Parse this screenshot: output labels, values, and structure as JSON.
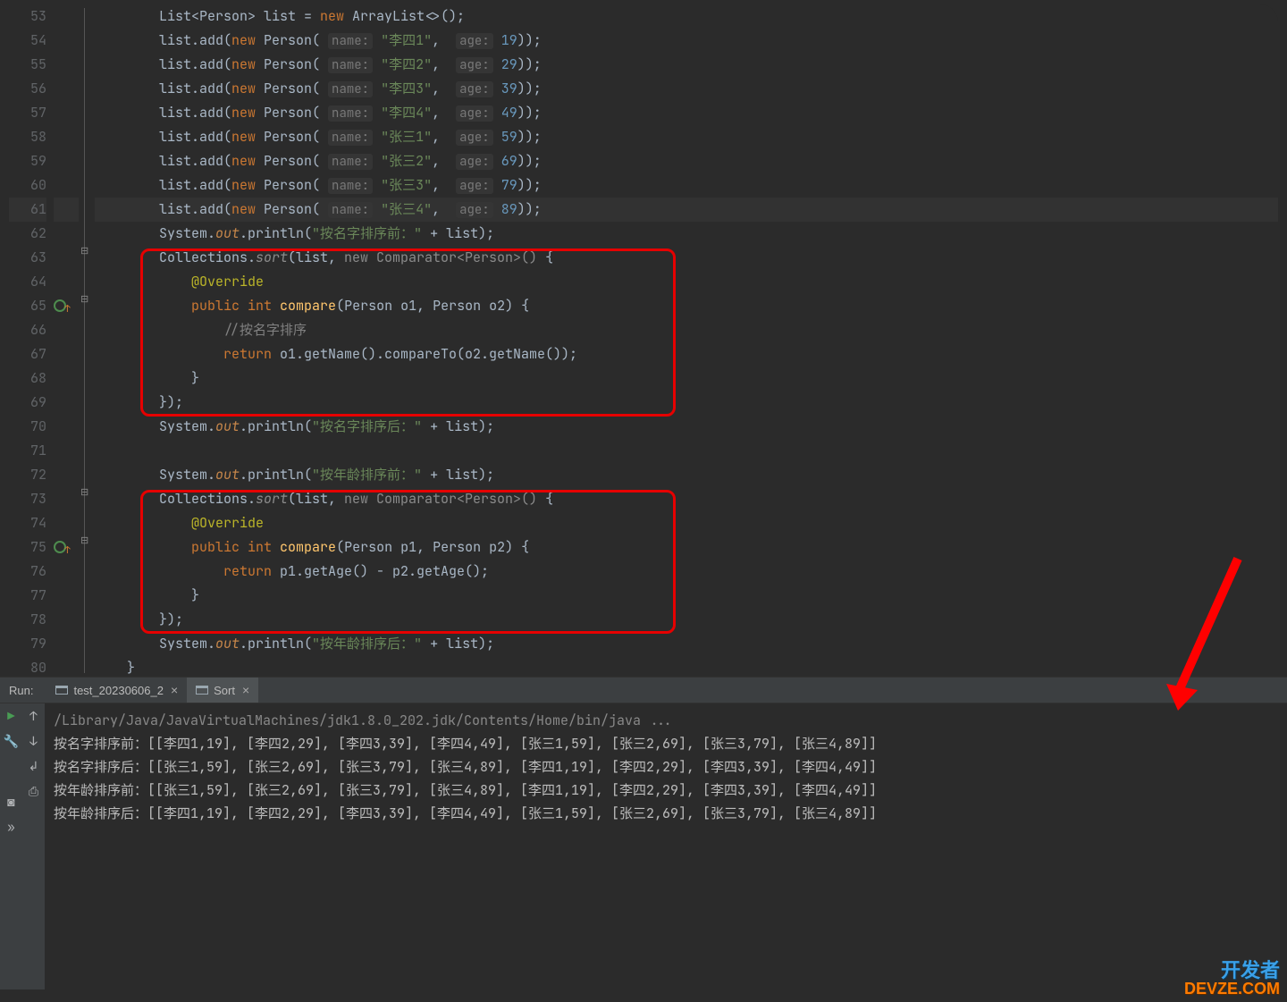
{
  "line_numbers": [
    "53",
    "54",
    "55",
    "56",
    "57",
    "58",
    "59",
    "60",
    "61",
    "62",
    "63",
    "64",
    "65",
    "66",
    "67",
    "68",
    "69",
    "70",
    "71",
    "72",
    "73",
    "74",
    "75",
    "76",
    "77",
    "78",
    "79",
    "80"
  ],
  "highlighted_line": "61",
  "code": {
    "l53": {
      "pre": "        ",
      "t": [
        "List<Person> list = ",
        "new",
        " ArrayList<>();"
      ]
    },
    "l54": {
      "name": "李四1",
      "age": "19"
    },
    "l55": {
      "name": "李四2",
      "age": "29"
    },
    "l56": {
      "name": "李四3",
      "age": "39"
    },
    "l57": {
      "name": "李四4",
      "age": "49"
    },
    "l58": {
      "name": "张三1",
      "age": "59"
    },
    "l59": {
      "name": "张三2",
      "age": "69"
    },
    "l60": {
      "name": "张三3",
      "age": "79"
    },
    "l61": {
      "name": "张三4",
      "age": "89"
    },
    "l62": {
      "str": "\"按名字排序前：\""
    },
    "l63": "        Collections.sort(list, new Comparator<Person>() {",
    "l64": "            @Override",
    "l65": "            public int compare(Person o1, Person o2) {",
    "l66": "                //按名字排序",
    "l67": "                return o1.getName().compareTo(o2.getName());",
    "l68": "            }",
    "l69": "        });",
    "l70": {
      "str": "\"按名字排序后：\""
    },
    "l72": {
      "str": "\"按年龄排序前：\""
    },
    "l73": "        Collections.sort(list, new Comparator<Person>() {",
    "l74": "            @Override",
    "l75": "            public int compare(Person p1, Person p2) {",
    "l76": "                return p1.getAge() - p2.getAge();",
    "l77": "            }",
    "l78": "        });",
    "l79": {
      "str": "\"按年龄排序后：\""
    }
  },
  "run": {
    "label": "Run:",
    "tabs": [
      {
        "label": "test_20230606_2"
      },
      {
        "label": "Sort"
      }
    ],
    "cmd": "/Library/Java/JavaVirtualMachines/jdk1.8.0_202.jdk/Contents/Home/bin/java ...",
    "out": [
      "按名字排序前：[[李四1,19], [李四2,29], [李四3,39], [李四4,49], [张三1,59], [张三2,69], [张三3,79], [张三4,89]]",
      "按名字排序后：[[张三1,59], [张三2,69], [张三3,79], [张三4,89], [李四1,19], [李四2,29], [李四3,39], [李四4,49]]",
      "按年龄排序前：[[张三1,59], [张三2,69], [张三3,79], [张三4,89], [李四1,19], [李四2,29], [李四3,39], [李四4,49]]",
      "按年龄排序后：[[李四1,19], [李四2,29], [李四3,39], [李四4,49], [张三1,59], [张三2,69], [张三3,79], [张三4,89]]"
    ]
  },
  "watermark": {
    "l1": "开发者",
    "l2": "DEVZE.COM"
  }
}
